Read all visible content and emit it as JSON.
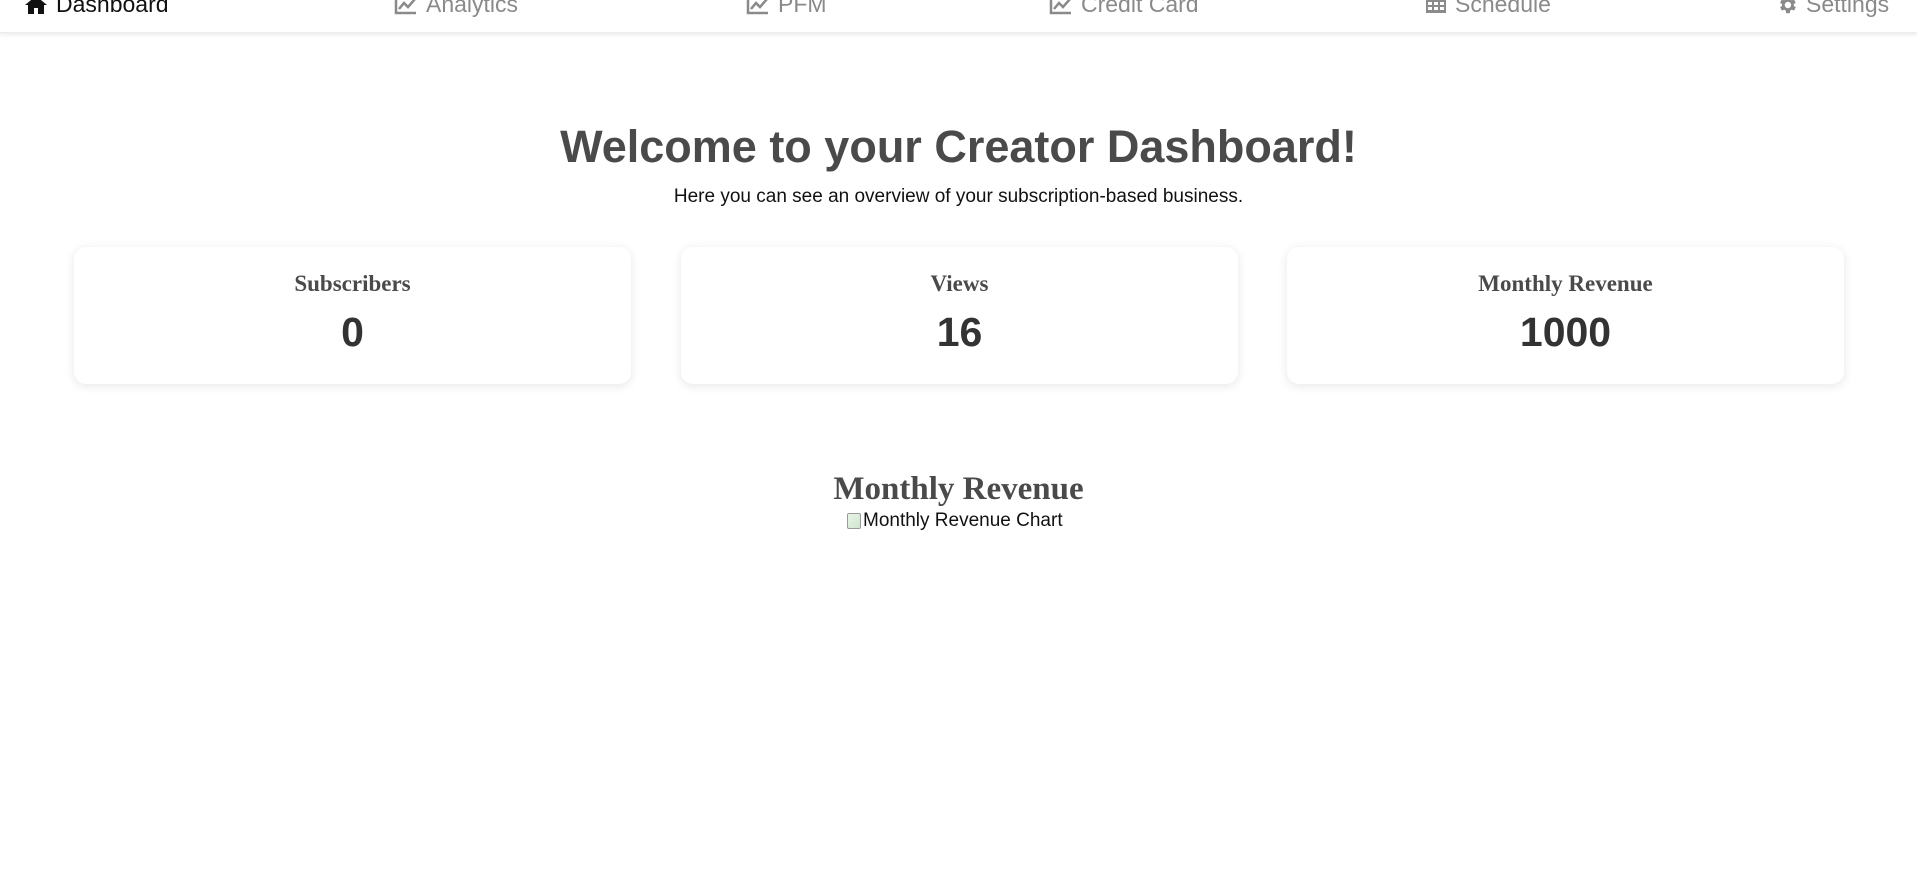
{
  "nav": {
    "items": [
      {
        "label": "Dashboard",
        "icon": "home-icon",
        "active": true
      },
      {
        "label": "Analytics",
        "icon": "line-chart-icon",
        "active": false
      },
      {
        "label": "PFM",
        "icon": "line-chart-icon",
        "active": false
      },
      {
        "label": "Credit Card",
        "icon": "line-chart-icon",
        "active": false
      },
      {
        "label": "Schedule",
        "icon": "table-icon",
        "active": false
      },
      {
        "label": "Settings",
        "icon": "gear-icon",
        "active": false
      }
    ]
  },
  "main": {
    "title": "Welcome to your Creator Dashboard!",
    "subtitle": "Here you can see an overview of your subscription-based business."
  },
  "stats": [
    {
      "label": "Subscribers",
      "value": "0"
    },
    {
      "label": "Views",
      "value": "16"
    },
    {
      "label": "Monthly Revenue",
      "value": "1000"
    }
  ],
  "chart_section": {
    "title": "Monthly Revenue",
    "image_alt": "Monthly Revenue Chart"
  },
  "colors": {
    "active_nav": "#111111",
    "inactive_nav": "#8a8a8a",
    "heading": "#4a4a4a"
  }
}
